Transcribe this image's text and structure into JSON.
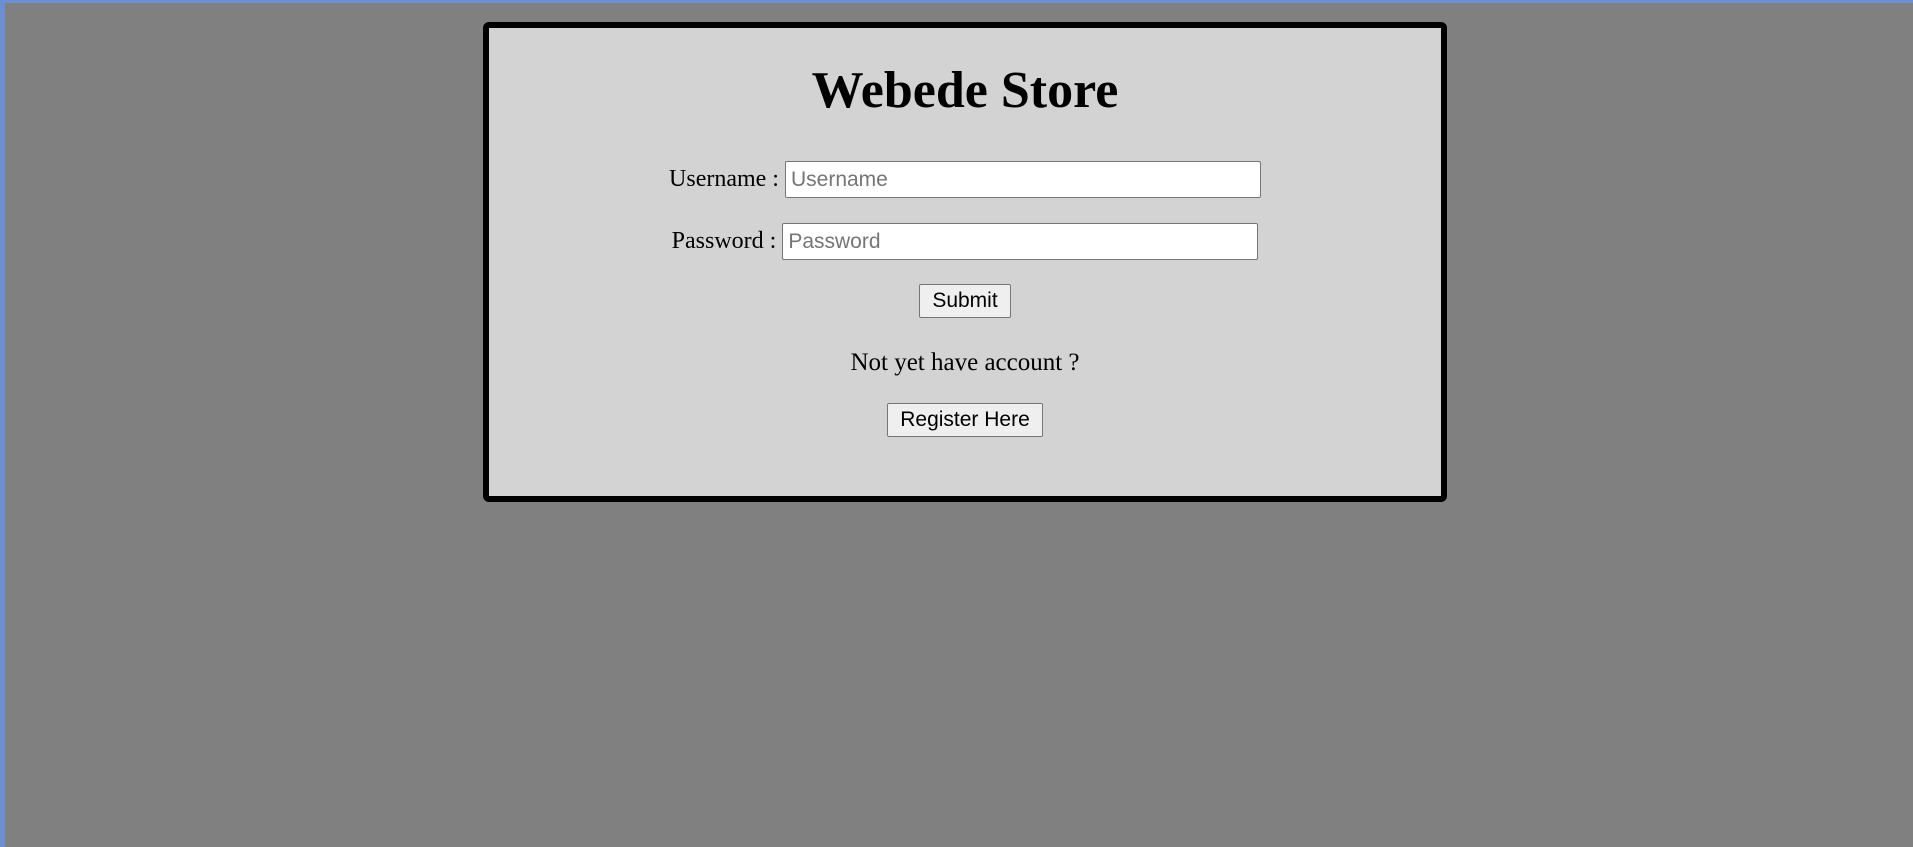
{
  "store": {
    "title": "Webede Store"
  },
  "login_form": {
    "username_label": "Username :",
    "username_placeholder": "Username",
    "username_value": "",
    "password_label": "Password :",
    "password_placeholder": "Password",
    "password_value": "",
    "submit_label": "Submit"
  },
  "register": {
    "prompt": "Not yet have account ?",
    "button_label": "Register Here"
  },
  "colors": {
    "page_background": "#808080",
    "card_background": "#d3d3d3",
    "card_border": "#000000",
    "window_edge": "#6b8fd6"
  }
}
